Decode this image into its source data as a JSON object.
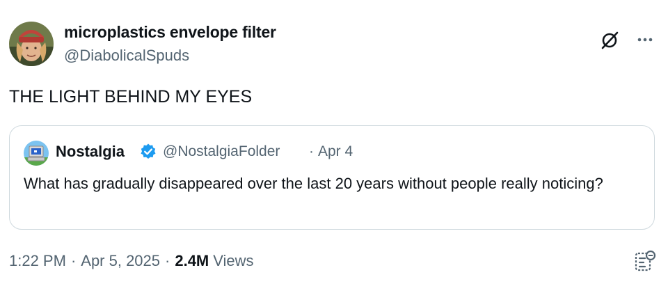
{
  "tweet": {
    "author": {
      "display_name": "microplastics envelope filter",
      "handle": "@DiabolicalSpuds"
    },
    "text": "THE LIGHT BEHIND MY EYES",
    "time": "1:22 PM",
    "date": "Apr 5, 2025",
    "separator": "·",
    "views_count": "2.4M",
    "views_label": "Views"
  },
  "quoted_tweet": {
    "display_name": "Nostalgia",
    "verified": true,
    "handle": "@NostalgiaFolder",
    "separator": "·",
    "date": "Apr 4",
    "text": "What has gradually disappeared over the last 20 years without people really noticing?"
  },
  "icons": {
    "grok": "grok-icon",
    "more": "more-options-icon",
    "verified": "verified-badge-icon",
    "analytics": "analytics-icon"
  },
  "colors": {
    "primary_text": "#0f1419",
    "secondary_text": "#536471",
    "border": "#cfd9de",
    "verified_blue": "#1d9bf0"
  }
}
